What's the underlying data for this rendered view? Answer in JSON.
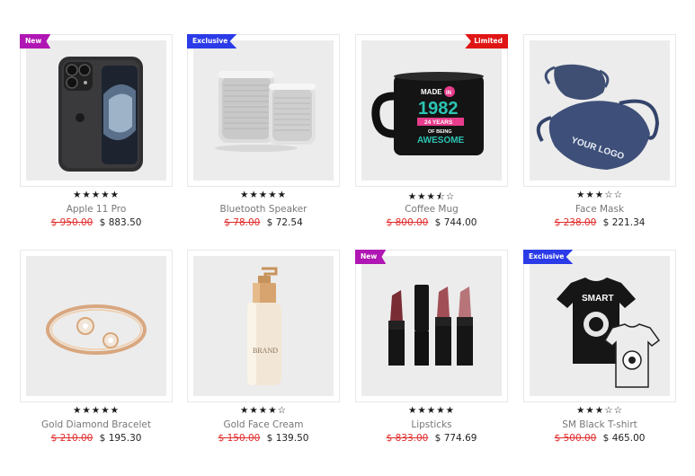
{
  "products": [
    {
      "badge": "New",
      "badge_color": "#b016b3",
      "badge_side": "left",
      "rating": 5,
      "stars": "★★★★★",
      "name": "Apple 11 Pro",
      "old_price": "$ 950.00",
      "price": "$ 883.50",
      "icon": "iphone-image"
    },
    {
      "badge": "Exclusive",
      "badge_color": "#2b3be8",
      "badge_side": "left",
      "rating": 5,
      "stars": "★★★★★",
      "name": "Bluetooth Speaker",
      "old_price": "$ 78.00",
      "price": "$ 72.54",
      "icon": "speaker-image"
    },
    {
      "badge": "Limited",
      "badge_color": "#e01515",
      "badge_side": "right",
      "rating": 3.5,
      "stars": "★★★⯪☆",
      "name": "Coffee Mug",
      "old_price": "$ 800.00",
      "price": "$ 744.00",
      "icon": "mug-image",
      "mug_text": {
        "line1": "MADE",
        "line1b": "IN",
        "year": "1982",
        "line3": "24 YEARS",
        "line4": "OF BEING",
        "line5": "AWESOME"
      }
    },
    {
      "badge": "",
      "badge_color": "",
      "badge_side": "",
      "rating": 3,
      "stars": "★★★☆☆",
      "name": "Face Mask",
      "old_price": "$ 238.00",
      "price": "$ 221.34",
      "icon": "face-mask-image",
      "mask_text": "YOUR LOGO"
    },
    {
      "badge": "",
      "badge_color": "",
      "badge_side": "",
      "rating": 5,
      "stars": "★★★★★",
      "name": "Gold Diamond Bracelet",
      "old_price": "$ 210.00",
      "price": "$ 195.30",
      "icon": "bracelet-image"
    },
    {
      "badge": "",
      "badge_color": "",
      "badge_side": "",
      "rating": 4,
      "stars": "★★★★☆",
      "name": "Gold Face Cream",
      "old_price": "$ 150.00",
      "price": "$ 139.50",
      "icon": "cream-bottle-image",
      "bottle_text": "BRAND"
    },
    {
      "badge": "New",
      "badge_color": "#b016b3",
      "badge_side": "left",
      "rating": 5,
      "stars": "★★★★★",
      "name": "Lipsticks",
      "old_price": "$ 833.00",
      "price": "$ 774.69",
      "icon": "lipsticks-image"
    },
    {
      "badge": "Exclusive",
      "badge_color": "#2b3be8",
      "badge_side": "left",
      "rating": 3,
      "stars": "★★★☆☆",
      "name": "SM Black T-shirt",
      "old_price": "$ 500.00",
      "price": "$ 465.00",
      "icon": "tshirt-image",
      "shirt_text": "SMART"
    }
  ]
}
